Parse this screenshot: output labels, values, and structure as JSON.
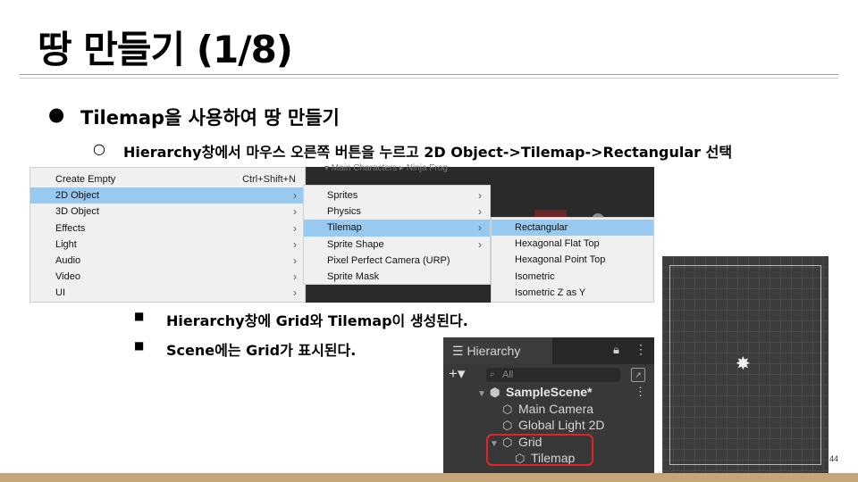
{
  "slide": {
    "title": "땅 만들기 (1/8)",
    "page_number": "44"
  },
  "bullets": {
    "level1": {
      "marker": "●",
      "text": "Tilemap을 사용하여 땅 만들기"
    },
    "level2": {
      "marker": "○",
      "text": "Hierarchy창에서 마우스 오른쪽 버튼을 누르고 2D Object->Tilemap->Rectangular 선택"
    },
    "level3": [
      {
        "marker": "■",
        "text": "Hierarchy창에 Grid와 Tilemap이 생성된다."
      },
      {
        "marker": "■",
        "text": "Scene에는 Grid가 표시된다."
      }
    ]
  },
  "context_menu": {
    "background_breadcrumb": "▾ Main Characters ▸ Ninja Frog",
    "main_items": [
      {
        "label": "Create Empty",
        "shortcut": "Ctrl+Shift+N",
        "arrow": "",
        "selected": false
      },
      {
        "label": "2D Object",
        "shortcut": "",
        "arrow": "›",
        "selected": true
      },
      {
        "label": "3D Object",
        "shortcut": "",
        "arrow": "›",
        "selected": false
      },
      {
        "label": "Effects",
        "shortcut": "",
        "arrow": "›",
        "selected": false
      },
      {
        "label": "Light",
        "shortcut": "",
        "arrow": "›",
        "selected": false
      },
      {
        "label": "Audio",
        "shortcut": "",
        "arrow": "›",
        "selected": false
      },
      {
        "label": "Video",
        "shortcut": "",
        "arrow": "›",
        "selected": false
      },
      {
        "label": "UI",
        "shortcut": "",
        "arrow": "›",
        "selected": false
      }
    ],
    "object2d_items": [
      {
        "label": "Sprites",
        "arrow": "›",
        "selected": false
      },
      {
        "label": "Physics",
        "arrow": "›",
        "selected": false
      },
      {
        "label": "Tilemap",
        "arrow": "›",
        "selected": true
      },
      {
        "label": "Sprite Shape",
        "arrow": "›",
        "selected": false
      },
      {
        "label": "Pixel Perfect Camera (URP)",
        "arrow": "",
        "selected": false
      },
      {
        "label": "Sprite Mask",
        "arrow": "",
        "selected": false
      }
    ],
    "tilemap_items": [
      {
        "label": "Rectangular",
        "selected": true
      },
      {
        "label": "Hexagonal Flat Top",
        "selected": false
      },
      {
        "label": "Hexagonal Point Top",
        "selected": false
      },
      {
        "label": "Isometric",
        "selected": false
      },
      {
        "label": "Isometric Z as Y",
        "selected": false
      }
    ]
  },
  "hierarchy": {
    "tab_label": "☰ Hierarchy",
    "lock_glyph": "ð",
    "menu_glyph": "⋮",
    "add_glyph": "+▾",
    "search_placeholder": "All",
    "search_glyph": "🔍",
    "rows": [
      {
        "name": "SampleScene*",
        "toggle": "▼",
        "icon": "unity-scene-icon",
        "glyph": "⬢",
        "indent": 0
      },
      {
        "name": "Main Camera",
        "toggle": "",
        "icon": "cube-icon",
        "glyph": "⬡",
        "indent": 1
      },
      {
        "name": "Global Light 2D",
        "toggle": "",
        "icon": "cube-icon",
        "glyph": "⬡",
        "indent": 1
      },
      {
        "name": "Grid",
        "toggle": "▼",
        "icon": "cube-icon",
        "glyph": "⬡",
        "indent": 1
      },
      {
        "name": "Tilemap",
        "toggle": "",
        "icon": "cube-icon",
        "glyph": "⬡",
        "indent": 2
      }
    ],
    "highlight_color": "#e0242a"
  },
  "scene_view": {
    "gizmo_glyph": "✸"
  },
  "colors": {
    "menu_highlight": "#99c9ef",
    "footer_bar": "#c7a57a",
    "editor_dark": "#383838"
  }
}
